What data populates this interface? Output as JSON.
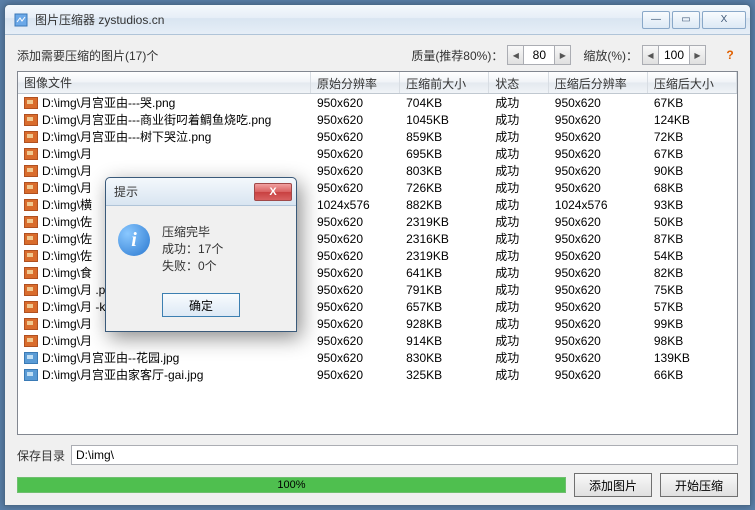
{
  "window": {
    "title": "图片压缩器 zystudios.cn",
    "minimize": "—",
    "maximize": "▭",
    "close": "X"
  },
  "top": {
    "count_label": "添加需要压缩的图片(17)个",
    "quality_label": "质量(推荐80%)：",
    "quality_value": "80",
    "zoom_label": "缩放(%)：",
    "zoom_value": "100",
    "help": "?"
  },
  "columns": {
    "c0": "图像文件",
    "c1": "原始分辨率",
    "c2": "压缩前大小",
    "c3": "状态",
    "c4": "压缩后分辨率",
    "c5": "压缩后大小"
  },
  "rows": [
    {
      "icon": "png",
      "path": "D:\\img\\月宫亚由---哭.png",
      "res": "950x620",
      "before": "704KB",
      "status": "成功",
      "res2": "950x620",
      "after": "67KB"
    },
    {
      "icon": "png",
      "path": "D:\\img\\月宫亚由---商业街叼着鲷鱼烧吃.png",
      "res": "950x620",
      "before": "1045KB",
      "status": "成功",
      "res2": "950x620",
      "after": "124KB"
    },
    {
      "icon": "png",
      "path": "D:\\img\\月宫亚由---树下哭泣.png",
      "res": "950x620",
      "before": "859KB",
      "status": "成功",
      "res2": "950x620",
      "after": "72KB"
    },
    {
      "icon": "png",
      "path": "D:\\img\\月",
      "res": "950x620",
      "before": "695KB",
      "status": "成功",
      "res2": "950x620",
      "after": "67KB"
    },
    {
      "icon": "png",
      "path": "D:\\img\\月",
      "res": "950x620",
      "before": "803KB",
      "status": "成功",
      "res2": "950x620",
      "after": "90KB"
    },
    {
      "icon": "png",
      "path": "D:\\img\\月",
      "res": "950x620",
      "before": "726KB",
      "status": "成功",
      "res2": "950x620",
      "after": "68KB"
    },
    {
      "icon": "png",
      "path": "D:\\img\\横",
      "res": "1024x576",
      "before": "882KB",
      "status": "成功",
      "res2": "1024x576",
      "after": "93KB"
    },
    {
      "icon": "png",
      "path": "D:\\img\\佐",
      "res": "950x620",
      "before": "2319KB",
      "status": "成功",
      "res2": "950x620",
      "after": "50KB"
    },
    {
      "icon": "png",
      "path": "D:\\img\\佐",
      "res": "950x620",
      "before": "2316KB",
      "status": "成功",
      "res2": "950x620",
      "after": "87KB"
    },
    {
      "icon": "png",
      "path": "D:\\img\\佐",
      "res": "950x620",
      "before": "2319KB",
      "status": "成功",
      "res2": "950x620",
      "after": "54KB"
    },
    {
      "icon": "png",
      "path": "D:\\img\\食",
      "res": "950x620",
      "before": "641KB",
      "status": "成功",
      "res2": "950x620",
      "after": "82KB"
    },
    {
      "icon": "png",
      "path": "D:\\img\\月                                    .png",
      "res": "950x620",
      "before": "791KB",
      "status": "成功",
      "res2": "950x620",
      "after": "75KB"
    },
    {
      "icon": "png",
      "path": "D:\\img\\月                                    -kong...",
      "res": "950x620",
      "before": "657KB",
      "status": "成功",
      "res2": "950x620",
      "after": "57KB"
    },
    {
      "icon": "png",
      "path": "D:\\img\\月",
      "res": "950x620",
      "before": "928KB",
      "status": "成功",
      "res2": "950x620",
      "after": "99KB"
    },
    {
      "icon": "png",
      "path": "D:\\img\\月",
      "res": "950x620",
      "before": "914KB",
      "status": "成功",
      "res2": "950x620",
      "after": "98KB"
    },
    {
      "icon": "jpg",
      "path": "D:\\img\\月宫亚由--花园.jpg",
      "res": "950x620",
      "before": "830KB",
      "status": "成功",
      "res2": "950x620",
      "after": "139KB"
    },
    {
      "icon": "jpg",
      "path": "D:\\img\\月宫亚由家客厅-gai.jpg",
      "res": "950x620",
      "before": "325KB",
      "status": "成功",
      "res2": "950x620",
      "after": "66KB"
    }
  ],
  "bottom": {
    "save_label": "保存目录",
    "save_path": "D:\\img\\"
  },
  "progress": {
    "pct": "100%"
  },
  "buttons": {
    "add": "添加图片",
    "start": "开始压缩"
  },
  "modal": {
    "title": "提示",
    "line1": "压缩完毕",
    "line2": "成功：17个",
    "line3": "失败：0个",
    "ok": "确定"
  }
}
